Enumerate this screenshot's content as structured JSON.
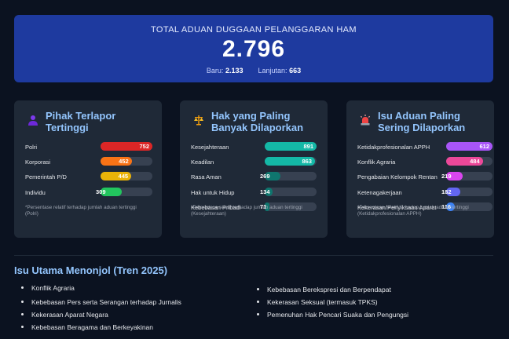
{
  "header": {
    "title": "TOTAL ADUAN DUGGAAN PELANGGARAN HAM",
    "total": "2.796",
    "baru_label": "Baru:",
    "baru_value": "2.133",
    "lanjutan_label": "Lanjutan:",
    "lanjutan_value": "663"
  },
  "cards": [
    {
      "title_line1": "Pihak Terlapor",
      "title_line2": "Tertinggi",
      "icon": "person-icon",
      "note": "*Persentase relatif terhadap jumlah aduan tertinggi (Polri)",
      "items": [
        {
          "label": "Polri",
          "value": 752,
          "pct": 1.0,
          "color": "#dc2626"
        },
        {
          "label": "Korporasi",
          "value": 452,
          "pct": 0.601,
          "color": "#f97316"
        },
        {
          "label": "Pemerintah P/D",
          "value": 445,
          "pct": 0.592,
          "color": "#eab308"
        },
        {
          "label": "Individu",
          "value": 309,
          "pct": 0.411,
          "color": "#22c55e"
        }
      ]
    },
    {
      "title_line1": "Hak yang Paling",
      "title_line2": "Banyak Dilaporkan",
      "icon": "scales-icon",
      "note": "*Persentase relatif terhadap jumlah aduan tertinggi (Kesejahteraan)",
      "items": [
        {
          "label": "Kesejahteraan",
          "value": 891,
          "pct": 1.0,
          "color": "#14b8a6"
        },
        {
          "label": "Keadilan",
          "value": 863,
          "pct": 0.969,
          "color": "#14b8a6"
        },
        {
          "label": "Rasa Aman",
          "value": 269,
          "pct": 0.302,
          "color": "#0f766e"
        },
        {
          "label": "Hak untuk Hidup",
          "value": 134,
          "pct": 0.15,
          "color": "#0f766e"
        },
        {
          "label": "Kebebasan Pribadi",
          "value": 71,
          "pct": 0.08,
          "color": "#0f766e"
        }
      ]
    },
    {
      "title_line1": "Isu Aduan Paling",
      "title_line2": "Sering Dilaporkan",
      "icon": "alarm-icon",
      "note": "*Persentase relatif terhadap jumlah aduan tertinggi (Ketidakprofesionalan APPH)",
      "items": [
        {
          "label": "Ketidakprofesionalan APPH",
          "value": 612,
          "pct": 1.0,
          "color": "#a855f7"
        },
        {
          "label": "Konflik Agraria",
          "value": 484,
          "pct": 0.791,
          "color": "#ec4899"
        },
        {
          "label": "Pengabaian Kelompok Rentan",
          "value": 219,
          "pct": 0.358,
          "color": "#d946ef"
        },
        {
          "label": "Ketenagakerjaan",
          "value": 182,
          "pct": 0.297,
          "color": "#6366f1"
        },
        {
          "label": "Kekerasan/Penyiksaan Aparat",
          "value": 116,
          "pct": 0.19,
          "color": "#3b82f6"
        }
      ]
    }
  ],
  "issues": {
    "title": "Isu Utama Menonjol (Tren 2025)",
    "left": [
      "Konflik Agraria",
      "Kebebasan Pers serta Serangan terhadap Jurnalis",
      "Kekerasan Aparat Negara",
      "Kebebasan Beragama dan Berkeyakinan"
    ],
    "right": [
      "Kebebasan Berekspresi dan Berpendapat",
      "Kekerasan Seksual (termasuk TPKS)",
      "Pemenuhan Hak Pencari Suaka dan Pengungsi"
    ]
  }
}
